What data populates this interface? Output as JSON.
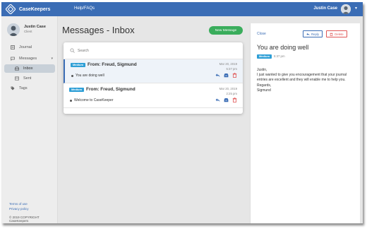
{
  "app": {
    "brand": "CaseKeepers",
    "help_link": "Help/FAQs",
    "user_name": "Justin Case"
  },
  "sidebar": {
    "user_name": "Justin Case",
    "user_role": "Client",
    "items": [
      {
        "label": "Journal",
        "icon": "journal-icon"
      },
      {
        "label": "Messages",
        "icon": "chat-icon"
      },
      {
        "label": "Inbox",
        "icon": "inbox-icon"
      },
      {
        "label": "Sent",
        "icon": "sent-icon"
      },
      {
        "label": "Tags",
        "icon": "tag-icon"
      }
    ],
    "terms_label": "Terms of use",
    "privacy_label": "Privacy policy",
    "copyright": "© 2019 COPYRIGHT CaseKeepers"
  },
  "main": {
    "title": "Messages - Inbox",
    "new_message_label": "New Message",
    "search_placeholder": "Search",
    "messages": [
      {
        "priority": "Medium",
        "from": "From: Freud, Sigmund",
        "date": "Mar 20, 2019",
        "time": "5:37 pm",
        "subject": "You are doing well",
        "selected": true
      },
      {
        "priority": "Medium",
        "from": "From: Freud, Sigmund",
        "date": "Mar 20, 2019",
        "time": "2:25 pm",
        "subject": "Welcome to CaseKeeper",
        "selected": false
      }
    ]
  },
  "detail": {
    "close_label": "Close",
    "reply_label": "Reply",
    "delete_label": "Delete",
    "subject": "You are doing well",
    "priority": "Medium",
    "time": "5:37 pm",
    "body_lines": [
      "Justin,",
      "I just wanted to give you encouragement that your journal entries are excellent and they will enable me to help you.",
      "Regards,",
      "Sigmund"
    ]
  },
  "colors": {
    "topbar": "#3b6db5",
    "new_message_button": "#3aad5c",
    "priority_badge": "#2e9fd6",
    "delete_red": "#e05555"
  }
}
